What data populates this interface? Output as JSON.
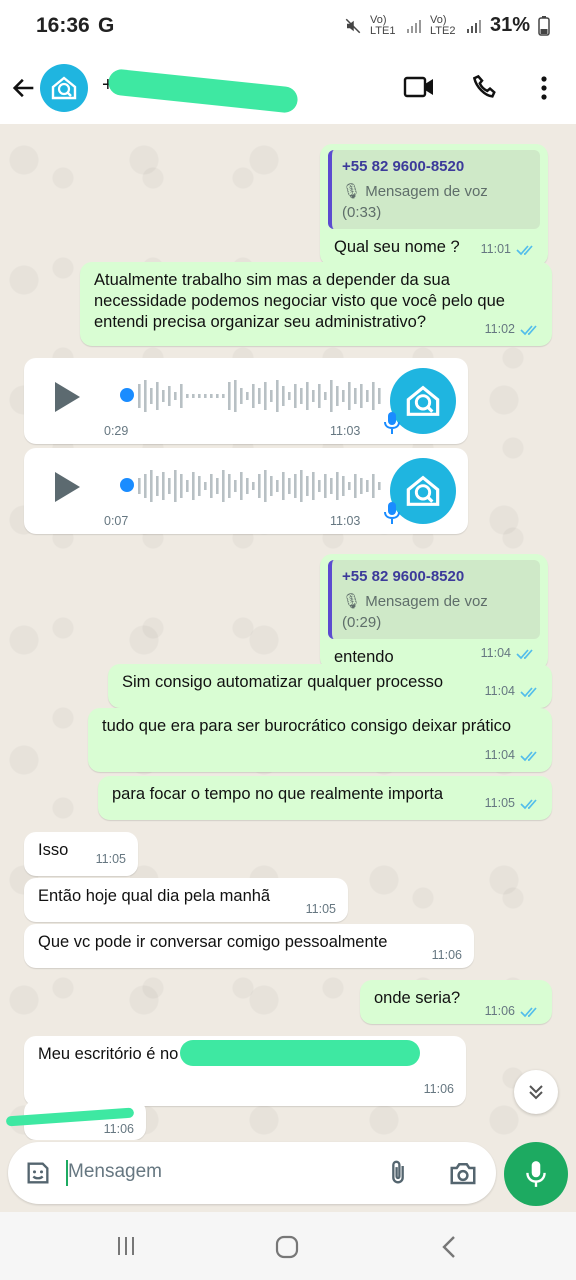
{
  "status": {
    "time": "16:36",
    "carrier_icon": "G",
    "sim1": "Vo) LTE1",
    "sim2": "Vo) LTE2",
    "battery": "31%"
  },
  "header": {
    "contact_prefix": "+",
    "contact_name_redacted": true
  },
  "messages": [
    {
      "id": "m1",
      "dir": "out",
      "quote_number": "+55 82 9600-8520",
      "quote_text": "Mensagem de voz (0:33)",
      "text": "Qual seu nome ?",
      "time": "11:01"
    },
    {
      "id": "m2",
      "dir": "out",
      "text": "Atualmente trabalho sim mas a depender da sua necessidade podemos negociar visto que você pelo que entendi precisa organizar seu administrativo?",
      "time": "11:02"
    },
    {
      "id": "v1",
      "dir": "in",
      "type": "voice",
      "duration": "0:29",
      "time": "11:03"
    },
    {
      "id": "v2",
      "dir": "in",
      "type": "voice",
      "duration": "0:07",
      "time": "11:03"
    },
    {
      "id": "m3",
      "dir": "out",
      "quote_number": "+55 82 9600-8520",
      "quote_text": "Mensagem de voz (0:29)",
      "text": "entendo",
      "time": "11:04"
    },
    {
      "id": "m4",
      "dir": "out",
      "text": "Sim consigo automatizar qualquer processo",
      "time": "11:04"
    },
    {
      "id": "m5",
      "dir": "out",
      "text": "tudo que era para ser burocrático consigo deixar prático",
      "time": "11:04"
    },
    {
      "id": "m6",
      "dir": "out",
      "text": "para focar o tempo no que realmente importa",
      "time": "11:05"
    },
    {
      "id": "m7",
      "dir": "in",
      "text": "Isso",
      "time": "11:05"
    },
    {
      "id": "m8",
      "dir": "in",
      "text": "Então hoje qual dia pela manhã",
      "time": "11:05"
    },
    {
      "id": "m9",
      "dir": "in",
      "text": "Que vc pode ir conversar comigo pessoalmente",
      "time": "11:06"
    },
    {
      "id": "m10",
      "dir": "out",
      "text": "onde seria?",
      "time": "11:06"
    },
    {
      "id": "m11",
      "dir": "in",
      "text": "Meu escritório é no",
      "time": "11:06"
    },
    {
      "id": "m12",
      "dir": "in",
      "text": "",
      "time": "11:06"
    }
  ],
  "composer": {
    "placeholder": "Mensagem"
  },
  "colors": {
    "out_bubble": "#d9fdd3",
    "in_bubble": "#ffffff",
    "accent_green": "#1daa61",
    "read_tick": "#53bdeb",
    "avatar": "#1fb5e0"
  },
  "icons": [
    "back-arrow-icon",
    "video-call-icon",
    "phone-icon",
    "more-vert-icon",
    "play-icon",
    "mic-small-icon",
    "double-tick-icon",
    "scroll-down-icon",
    "sticker-icon",
    "attach-icon",
    "camera-icon",
    "mic-icon",
    "nav-recents-icon",
    "nav-home-icon",
    "nav-back-icon"
  ]
}
